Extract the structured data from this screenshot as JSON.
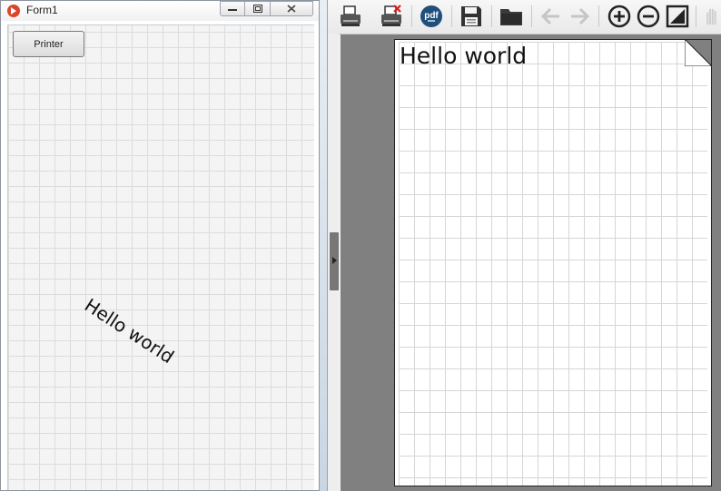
{
  "form_window": {
    "title": "Form1",
    "caption_buttons": {
      "minimize": "—",
      "maximize": "☐",
      "close": "✕"
    },
    "printer_button_label": "Printer",
    "canvas_text": "Hello world"
  },
  "preview_window": {
    "toolbar": [
      {
        "name": "print-icon",
        "enabled": true
      },
      {
        "name": "print-setup-icon",
        "enabled": true
      },
      {
        "name": "pdf-icon",
        "enabled": true
      },
      {
        "name": "save-icon",
        "enabled": true
      },
      {
        "name": "open-folder-icon",
        "enabled": true
      },
      {
        "name": "prev-page-icon",
        "enabled": false
      },
      {
        "name": "next-page-icon",
        "enabled": false
      },
      {
        "name": "zoom-in-icon",
        "enabled": true
      },
      {
        "name": "zoom-out-icon",
        "enabled": true
      },
      {
        "name": "fit-page-icon",
        "enabled": true
      },
      {
        "name": "hand-icon",
        "enabled": false
      }
    ],
    "pdf_badge_text": "pdf",
    "page_text": "Hello world"
  },
  "colors": {
    "viewport_bg": "#808080",
    "pdf_badge": "#1f4f7a",
    "disabled_icon": "#c6c6c6"
  }
}
